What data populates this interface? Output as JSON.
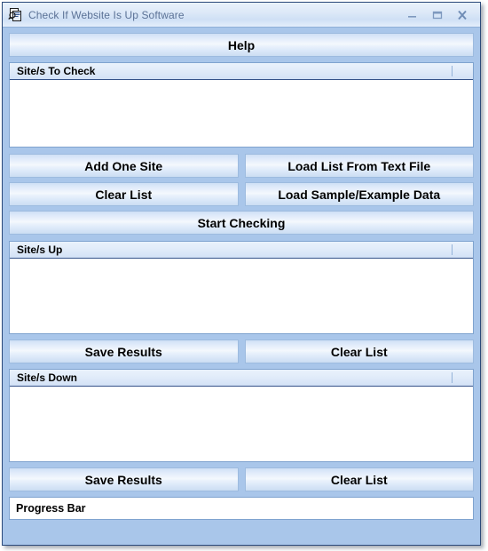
{
  "window": {
    "title": "Check If Website Is Up Software",
    "icon": "app-window-icon",
    "controls": {
      "minimize": "minimize-icon",
      "maximize": "maximize-icon",
      "close": "close-icon"
    },
    "colors": {
      "window_background": "#a9c6ea",
      "window_border": "#2b4a7a",
      "titlebar_text": "#5b7296",
      "button_border": "#9dbbdf",
      "listbox_border": "#7fa3cf",
      "header_underline": "#35538a",
      "field_background": "#ffffff"
    }
  },
  "toolbar": {
    "help_label": "Help"
  },
  "sites_to_check": {
    "header": "Site/s To Check",
    "rows": []
  },
  "check_actions": {
    "add_one_site": "Add One Site",
    "load_list_from_text_file": "Load List From Text File",
    "clear_list": "Clear List",
    "load_sample_example_data": "Load Sample/Example Data",
    "start_checking": "Start Checking"
  },
  "sites_up": {
    "header": "Site/s Up",
    "rows": [],
    "save_results": "Save Results",
    "clear_list": "Clear List"
  },
  "sites_down": {
    "header": "Site/s Down",
    "rows": [],
    "save_results": "Save Results",
    "clear_list": "Clear List"
  },
  "progress": {
    "label": "Progress Bar",
    "value": ""
  }
}
